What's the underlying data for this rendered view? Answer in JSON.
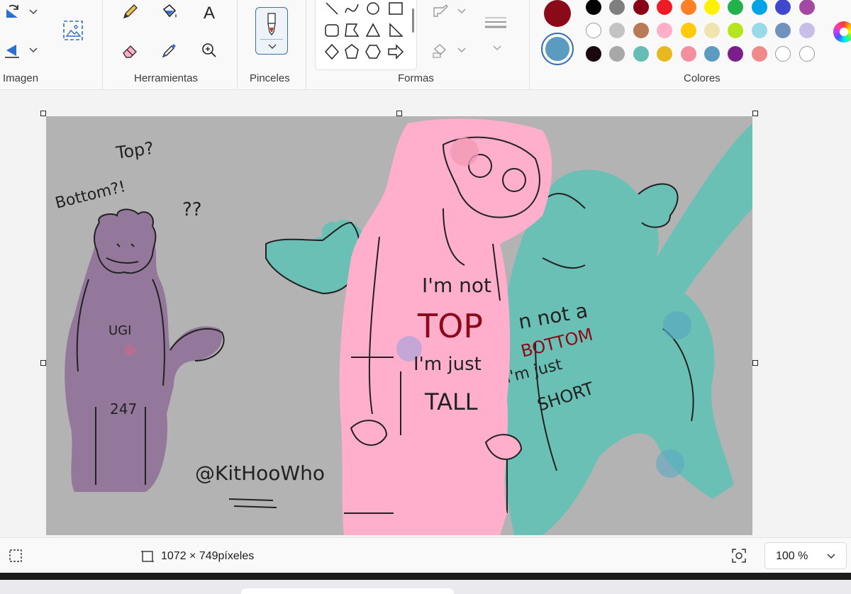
{
  "ribbon": {
    "groups": {
      "image": "Imagen",
      "tools": "Herramientas",
      "brushes": "Pinceles",
      "shapes": "Formas",
      "colors": "Colores"
    },
    "icons": {
      "rotate": "rotate-icon",
      "flip": "flip-icon",
      "select": "select-icon",
      "pencil": "pencil-icon",
      "fill": "fill-bucket-icon",
      "text": "text-icon",
      "eraser": "eraser-icon",
      "picker": "color-picker-icon",
      "zoom": "magnifier-icon",
      "brush": "brush-icon",
      "outline": "shape-outline-icon",
      "fill_shape": "shape-fill-icon",
      "size": "stroke-size-icon"
    },
    "text_tool_glyph": "A",
    "colors": {
      "color1": "#8b0a1a",
      "color2": "#5b9bbf",
      "palette": [
        [
          "#000000",
          "#7f7f7f",
          "#880015",
          "#ed1c24",
          "#ff7f27",
          "#fff200",
          "#22b14c",
          "#00a2e8",
          "#3f48cc",
          "#a349a4"
        ],
        [
          "#ffffff",
          "#c3c3c3",
          "#b97a57",
          "#ffaec9",
          "#ffc90e",
          "#efe4b0",
          "#b5e61d",
          "#99d9ea",
          "#7092be",
          "#c8bfe7"
        ],
        [
          "#1a0a0f",
          "#a8a8a8",
          "#66bdb3",
          "#e8b820",
          "#f48fa0",
          "#5b9bbf",
          "#7a1f8a",
          "#f08a8a",
          "#ffffff",
          "#ffffff"
        ]
      ]
    }
  },
  "canvas": {
    "background": "#b3b3b3",
    "texts": {
      "top_q": "Top?",
      "bottom_q": "Bottom?!",
      "qq": "??",
      "shirt1_line1": "I'm not",
      "shirt1_top": "TOP",
      "shirt1_line3": "I'm just",
      "shirt1_line4": "TALL",
      "shirt2_line1": "n not a",
      "shirt2_bottom": "BOTTOM",
      "shirt2_line3": "I'm just",
      "shirt2_line4": "SHORT",
      "jacket1": "UGI",
      "jacket2": "247",
      "signature": "@KitHooWho"
    }
  },
  "status": {
    "dimensions": "1072 × 749píxeles",
    "zoom": "100 %",
    "icons": {
      "selection": "selection-icon",
      "canvas_size": "canvas-size-icon",
      "fit": "fit-to-window-icon",
      "zoom_caret": "chevron-down-icon"
    }
  }
}
